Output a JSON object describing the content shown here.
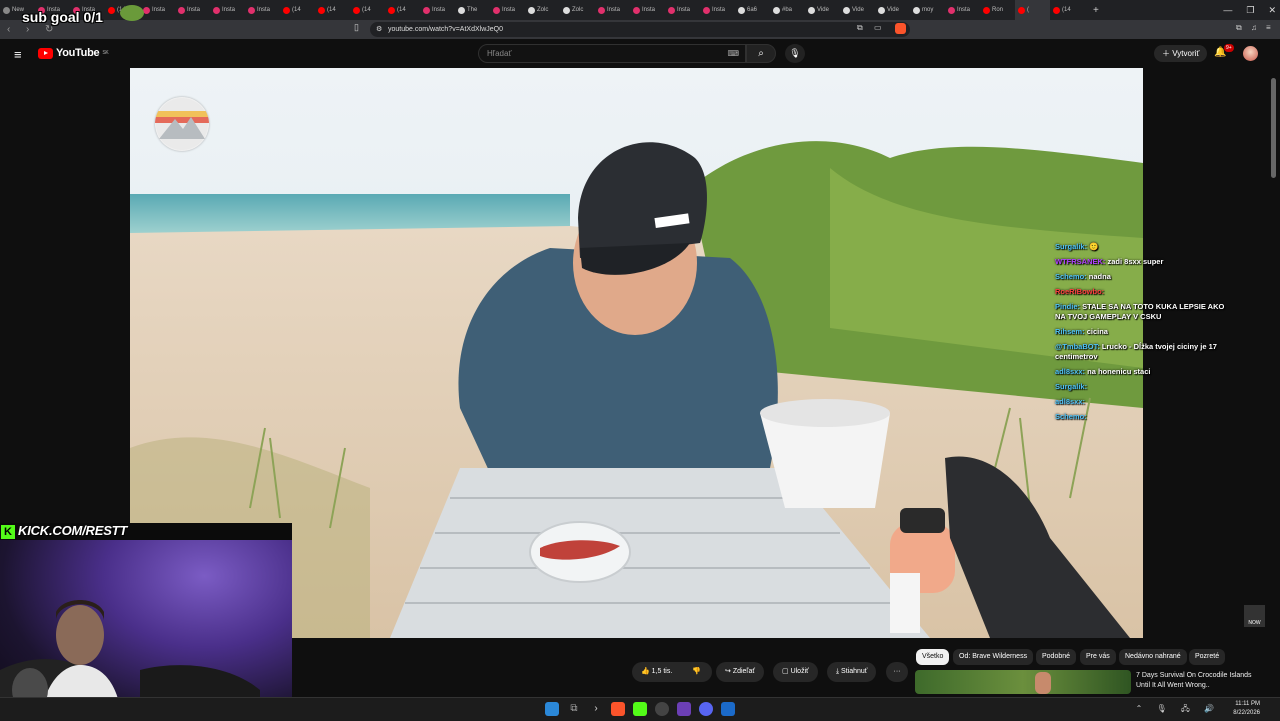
{
  "browser": {
    "tabs": [
      {
        "label": "New",
        "icon": "#888"
      },
      {
        "label": "Insta",
        "icon": "#e1306c"
      },
      {
        "label": "Insta",
        "icon": "#e1306c"
      },
      {
        "label": "(14",
        "icon": "#f00"
      },
      {
        "label": "Insta",
        "icon": "#e1306c"
      },
      {
        "label": "Insta",
        "icon": "#e1306c"
      },
      {
        "label": "Insta",
        "icon": "#e1306c"
      },
      {
        "label": "Insta",
        "icon": "#e1306c"
      },
      {
        "label": "(14",
        "icon": "#f00"
      },
      {
        "label": "(14",
        "icon": "#f00"
      },
      {
        "label": "(14",
        "icon": "#f00"
      },
      {
        "label": "(14",
        "icon": "#f00"
      },
      {
        "label": "Insta",
        "icon": "#e1306c"
      },
      {
        "label": "The",
        "icon": "#ddd"
      },
      {
        "label": "Insta",
        "icon": "#e1306c"
      },
      {
        "label": "Zolc",
        "icon": "#ddd"
      },
      {
        "label": "Zolc",
        "icon": "#ddd"
      },
      {
        "label": "Insta",
        "icon": "#e1306c"
      },
      {
        "label": "Insta",
        "icon": "#e1306c"
      },
      {
        "label": "Insta",
        "icon": "#e1306c"
      },
      {
        "label": "Insta",
        "icon": "#e1306c"
      },
      {
        "label": "6a6",
        "icon": "#ddd"
      },
      {
        "label": "#ba",
        "icon": "#ddd"
      },
      {
        "label": "Vide",
        "icon": "#ddd"
      },
      {
        "label": "Vide",
        "icon": "#ddd"
      },
      {
        "label": "Vide",
        "icon": "#ddd"
      },
      {
        "label": "moy",
        "icon": "#ddd"
      },
      {
        "label": "Insta",
        "icon": "#e1306c"
      },
      {
        "label": "Ron",
        "icon": "#f00"
      },
      {
        "label": "(",
        "icon": "#f00",
        "active": true
      },
      {
        "label": "(14",
        "icon": "#f00"
      }
    ],
    "new_tab": "+",
    "url": "youtube.com/watch?v=AtXdXlwJeQ0",
    "win_controls": [
      "—",
      "❐",
      "✕"
    ]
  },
  "youtube": {
    "logo": "YouTube",
    "region": "SK",
    "search_placeholder": "Hľadať",
    "create_label": "Vytvoriť",
    "notif_count": "9+"
  },
  "overlay": {
    "sub_goal": "sub goal 0/1",
    "kick_url": "KICK.COM/RESTT",
    "now_label": "NOW"
  },
  "chat": [
    {
      "user": "Surgalik:",
      "text": "🙂",
      "color": "#4fc3f7"
    },
    {
      "user": "WTFRSANEK:",
      "text": "zadi 8sxx super",
      "color": "#b040ff"
    },
    {
      "user": "Schemo:",
      "text": "nadna",
      "color": "#4fc3f7"
    },
    {
      "user": "RoeRiBowbo:",
      "text": "",
      "color": "#ff4040"
    },
    {
      "user": "Pindie:",
      "text": "STALE SA NA TOTO KUKA LEPSIE AKO NA TVOJ GAMEPLAY V CSKU",
      "color": "#4fc3f7"
    },
    {
      "user": "Rihsem:",
      "text": "cicina",
      "color": "#4fc3f7"
    },
    {
      "user": "@TmbaBOT:",
      "text": "Lrucko - Dĺžka tvojej ciciny je 17 centimetrov",
      "color": "#4fc3f7"
    },
    {
      "user": "adl8sxx:",
      "text": "na honenicu staci",
      "color": "#4fc3f7"
    },
    {
      "user": "Surgalik:",
      "text": "",
      "color": "#4fc3f7"
    },
    {
      "user": "adl8sxx:",
      "text": "",
      "color": "#4fc3f7"
    },
    {
      "user": "Schemo:",
      "text": "",
      "color": "#4fc3f7"
    }
  ],
  "actions": {
    "like_count": "1,5 tis.",
    "share": "Zdieľať",
    "save": "Uložiť",
    "download": "Stiahnuť",
    "more": "···"
  },
  "chips": [
    {
      "label": "Všetko",
      "active": true
    },
    {
      "label": "Od: Brave Wilderness",
      "active": false
    },
    {
      "label": "Podobné",
      "active": false
    },
    {
      "label": "Pre vás",
      "active": false
    },
    {
      "label": "Nedávno nahrané",
      "active": false
    },
    {
      "label": "Pozreté",
      "active": false
    }
  ],
  "related": {
    "title": "7 Days Survival On Crocodile Islands Until It All Went Wrong.."
  },
  "taskbar": {
    "time": "11:11 PM",
    "date": "8/22/2026",
    "tray": "⌃ 🎙 🖧 🔊"
  }
}
